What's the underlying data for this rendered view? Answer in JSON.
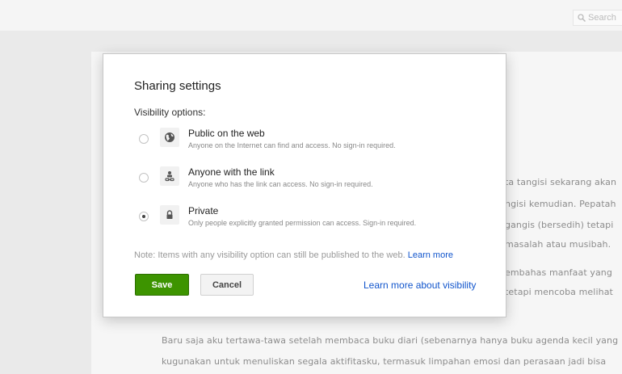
{
  "header": {
    "search_placeholder": "Search"
  },
  "background_text": [
    "ta tangisi sekarang akan",
    "ngisi kemudian. Pepatah",
    "gangis (bersedih) tetapi",
    "masalah atau musibah.",
    "embahas manfaat yang",
    "tetapi mencoba melihat",
    "Baru saja aku tertawa-tawa setelah membaca buku diari (sebenarnya hanya buku agenda kecil yang",
    "kugunakan untuk menuliskan segala aktifitasku, termasuk limpahan emosi dan perasaan jadi bisa"
  ],
  "dialog": {
    "title": "Sharing settings",
    "visibility_label": "Visibility options:",
    "options": [
      {
        "icon": "globe-icon",
        "title": "Public on the web",
        "description": "Anyone on the Internet can find and access. No sign-in required.",
        "selected": false
      },
      {
        "icon": "people-link-icon",
        "title": "Anyone with the link",
        "description": "Anyone who has the link can access. No sign-in required.",
        "selected": false
      },
      {
        "icon": "lock-icon",
        "title": "Private",
        "description": "Only people explicitly granted permission can access. Sign-in required.",
        "selected": true
      }
    ],
    "note": "Note: Items with any visibility option can still be published to the web.",
    "note_link": "Learn more",
    "save_label": "Save",
    "cancel_label": "Cancel",
    "learn_more_visibility": "Learn more about visibility"
  },
  "colors": {
    "save_button": "#3d9400",
    "link": "#1155cc"
  }
}
